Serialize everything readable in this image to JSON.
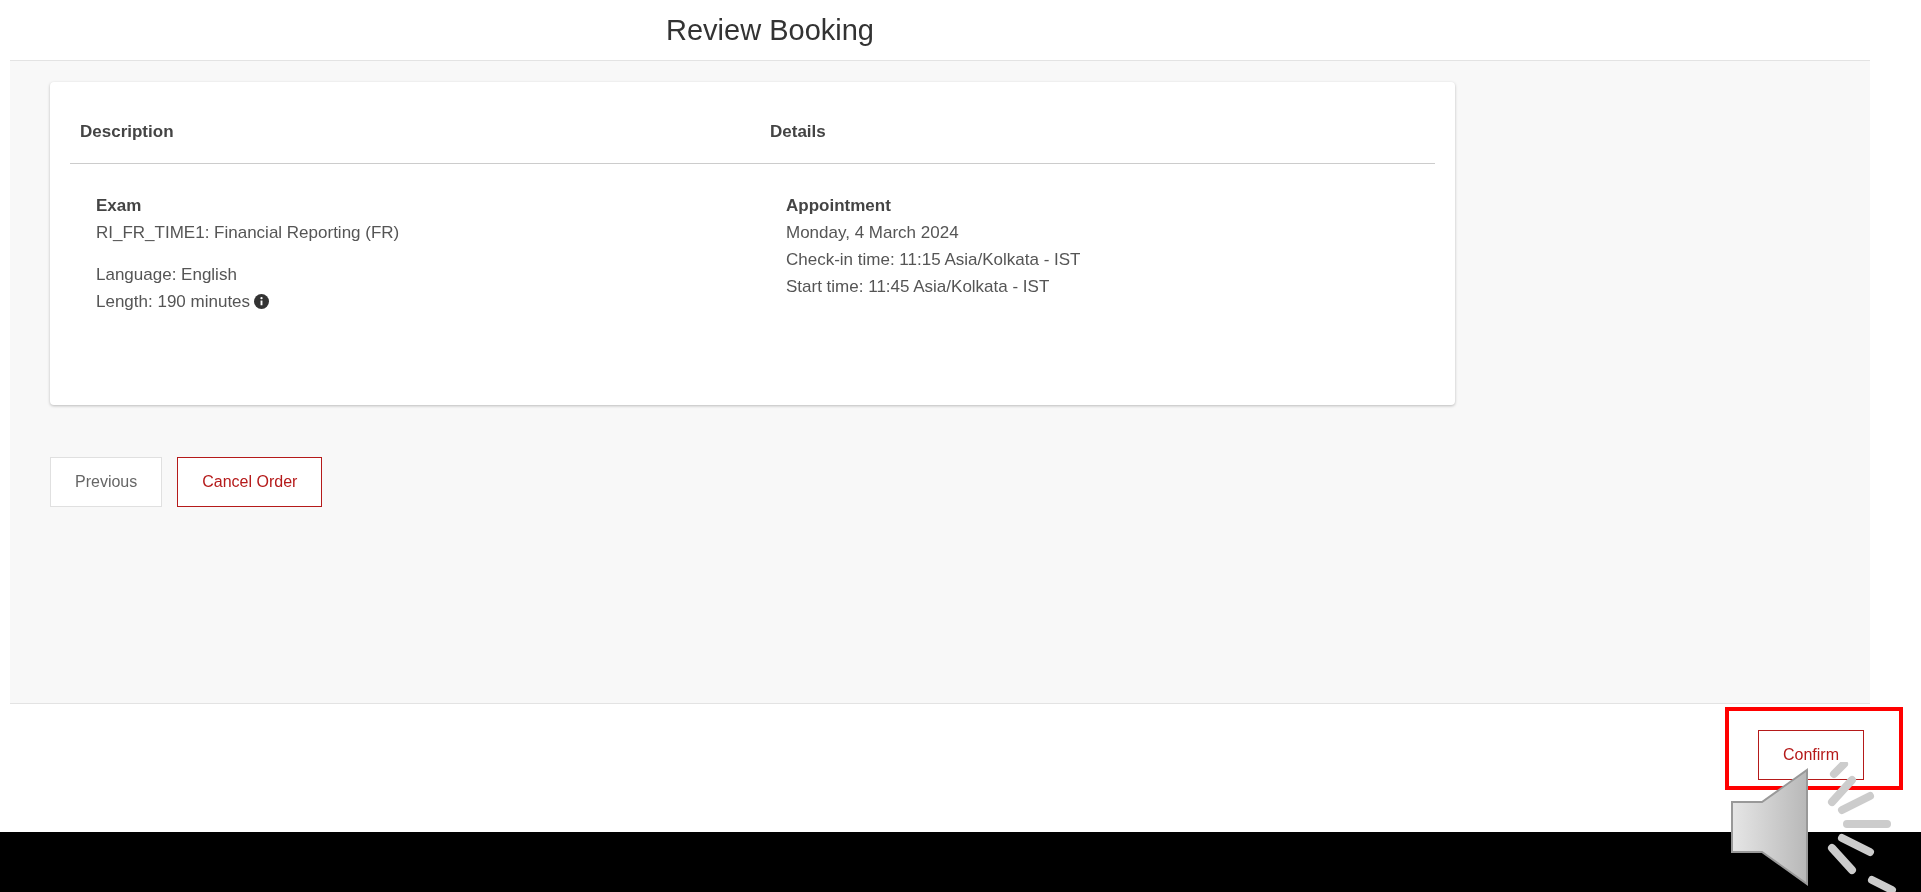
{
  "page": {
    "title": "Review Booking"
  },
  "summary": {
    "columns": [
      "Description",
      "Details"
    ],
    "exam": {
      "heading": "Exam",
      "name": "RI_FR_TIME1: Financial Reporting (FR)",
      "language": "Language: English",
      "length": "Length: 190 minutes"
    },
    "appointment": {
      "heading": "Appointment",
      "lines": [
        "Monday, 4 March 2024",
        "Check-in time: 11:15 Asia/Kolkata - IST",
        "Start time: 11:45 Asia/Kolkata - IST"
      ]
    }
  },
  "actions": [
    {
      "label": "Previous",
      "kind": "secondary"
    },
    {
      "label": "Cancel Order",
      "kind": "danger"
    }
  ],
  "footer": {
    "confirm": "Confirm",
    "highlighted": true
  }
}
